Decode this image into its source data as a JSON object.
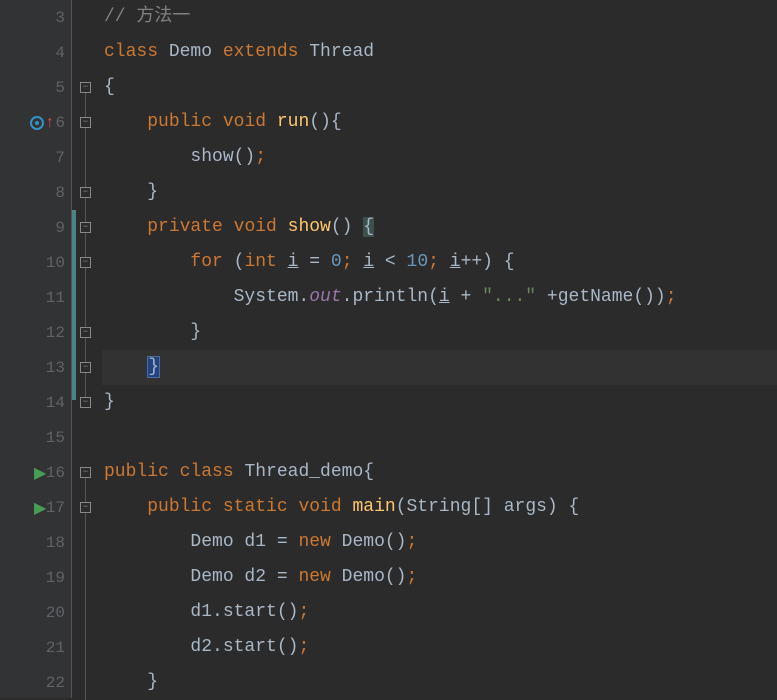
{
  "lines": {
    "l3": {
      "num": "3"
    },
    "l4": {
      "num": "4"
    },
    "l5": {
      "num": "5"
    },
    "l6": {
      "num": "6"
    },
    "l7": {
      "num": "7"
    },
    "l8": {
      "num": "8"
    },
    "l9": {
      "num": "9"
    },
    "l10": {
      "num": "10"
    },
    "l11": {
      "num": "11"
    },
    "l12": {
      "num": "12"
    },
    "l13": {
      "num": "13"
    },
    "l14": {
      "num": "14"
    },
    "l15": {
      "num": "15"
    },
    "l16": {
      "num": "16"
    },
    "l17": {
      "num": "17"
    },
    "l18": {
      "num": "18"
    },
    "l19": {
      "num": "19"
    },
    "l20": {
      "num": "20"
    },
    "l21": {
      "num": "21"
    },
    "l22": {
      "num": "22"
    }
  },
  "code": {
    "c3_comment": "// 方法一",
    "c4_class": "class ",
    "c4_demo": "Demo ",
    "c4_extends": "extends ",
    "c4_thread": "Thread",
    "c5_brace": "{",
    "c6_public": "public ",
    "c6_void": "void ",
    "c6_run": "run",
    "c6_rest": "(){",
    "c7_show": "show()",
    "c7_semi": ";",
    "c8_brace": "}",
    "c9_private": "private ",
    "c9_void": "void ",
    "c9_show": "show",
    "c9_paren": "() ",
    "c9_brace": "{",
    "c10_for": "for ",
    "c10_open": "(",
    "c10_int": "int ",
    "c10_i1": "i",
    "c10_eq": " = ",
    "c10_zero": "0",
    "c10_s1": "; ",
    "c10_i2": "i",
    "c10_lt": " < ",
    "c10_ten": "10",
    "c10_s2": "; ",
    "c10_i3": "i",
    "c10_inc": "++) {",
    "c11_sys": "System.",
    "c11_out": "out",
    "c11_print": ".println(",
    "c11_i": "i",
    "c11_plus1": " + ",
    "c11_str": "\"...\"",
    "c11_plus2": " +getName())",
    "c11_semi": ";",
    "c12_brace": "}",
    "c13_brace": "}",
    "c14_brace": "}",
    "c16_public": "public ",
    "c16_class": "class ",
    "c16_name": "Thread_demo",
    "c16_brace": "{",
    "c17_public": "public ",
    "c17_static": "static ",
    "c17_void": "void ",
    "c17_main": "main",
    "c17_args": "(String[] args) {",
    "c18_demo1": "Demo d1 = ",
    "c18_new": "new ",
    "c18_ctor": "Demo()",
    "c18_semi": ";",
    "c19_demo2": "Demo d2 = ",
    "c19_new": "new ",
    "c19_ctor": "Demo()",
    "c19_semi": ";",
    "c20_start": "d1.start()",
    "c20_semi": ";",
    "c21_start": "d2.start()",
    "c21_semi": ";",
    "c22_brace": "}"
  }
}
